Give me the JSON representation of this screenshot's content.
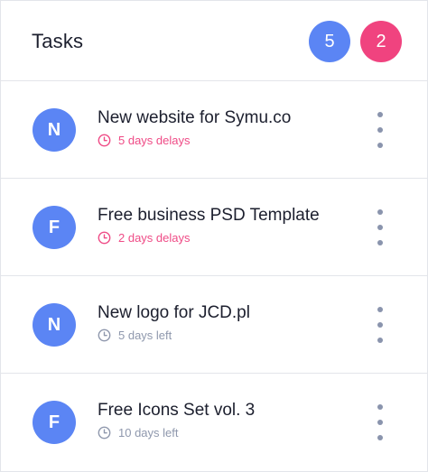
{
  "header": {
    "title": "Tasks",
    "badge_blue": "5",
    "badge_pink": "2"
  },
  "colors": {
    "blue": "#5b85f4",
    "pink": "#f0437f",
    "delay": "#ef4b86",
    "left": "#8f98ad"
  },
  "tasks": [
    {
      "initial": "N",
      "title": "New website for Symu.co",
      "status": "5 days delays",
      "status_type": "delay",
      "icon": "clock-icon"
    },
    {
      "initial": "F",
      "title": "Free business PSD Template",
      "status": "2 days delays",
      "status_type": "delay",
      "icon": "clock-icon"
    },
    {
      "initial": "N",
      "title": "New logo for JCD.pl",
      "status": "5 days left",
      "status_type": "left",
      "icon": "clock-icon"
    },
    {
      "initial": "F",
      "title": "Free Icons Set vol. 3",
      "status": "10 days left",
      "status_type": "left",
      "icon": "clock-icon"
    }
  ]
}
